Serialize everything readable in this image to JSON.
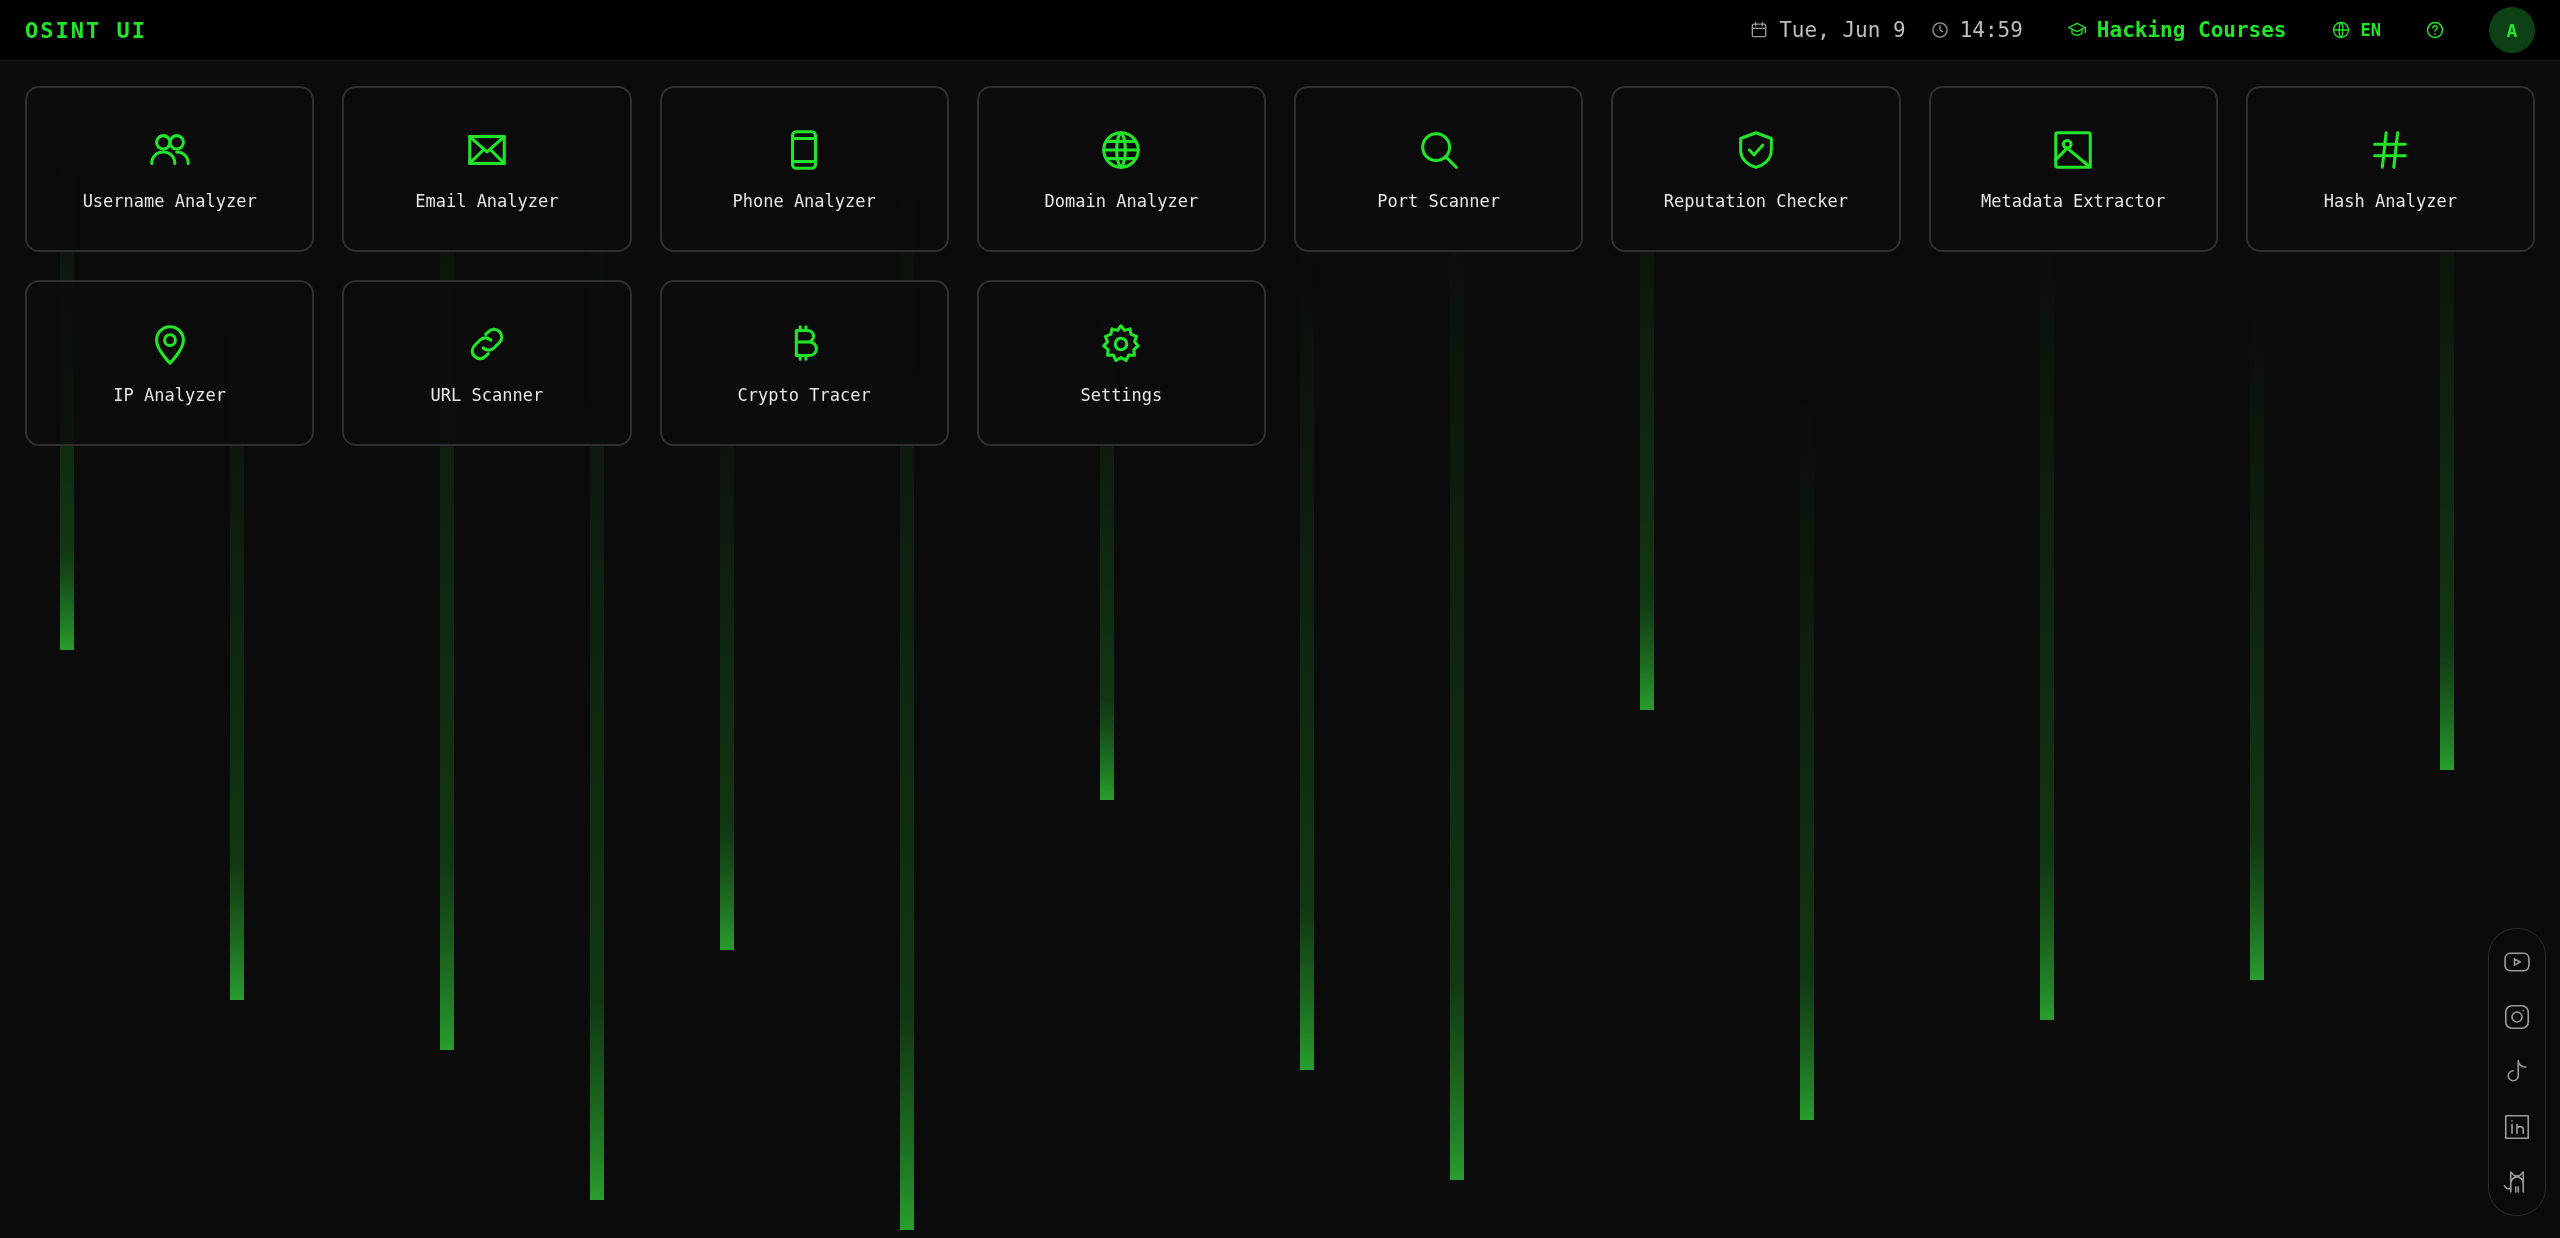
{
  "header": {
    "logo": "OSINT UI",
    "date": "Tue, Jun 9",
    "time": "14:59",
    "courses_link": "Hacking Courses",
    "language": "EN",
    "avatar": "A"
  },
  "tools": [
    {
      "label": "Username Analyzer"
    },
    {
      "label": "Email Analyzer"
    },
    {
      "label": "Phone Analyzer"
    },
    {
      "label": "Domain Analyzer"
    },
    {
      "label": "Port Scanner"
    },
    {
      "label": "Reputation Checker"
    },
    {
      "label": "Metadata Extractor"
    },
    {
      "label": "Hash Analyzer"
    },
    {
      "label": "IP Analyzer"
    },
    {
      "label": "URL Scanner"
    },
    {
      "label": "Crypto Tracer"
    },
    {
      "label": "Settings"
    }
  ]
}
